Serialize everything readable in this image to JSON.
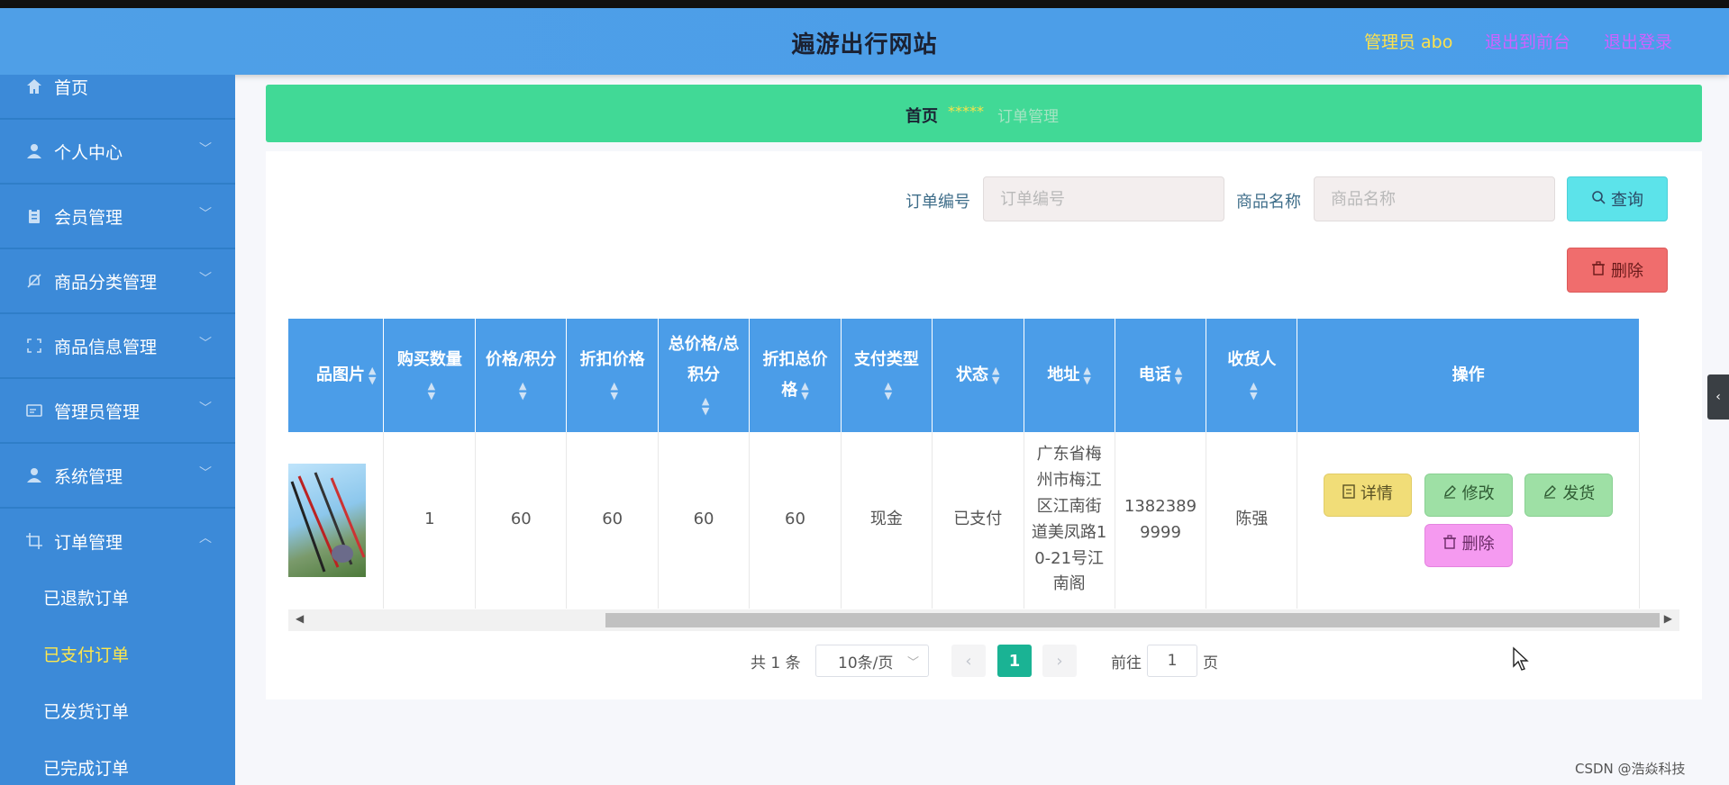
{
  "header": {
    "site_title": "遍游出行网站",
    "admin_label": "管理员 abo",
    "back_to_front": "退出到前台",
    "logout": "退出登录"
  },
  "sidebar": {
    "items": [
      {
        "label": "首页",
        "icon": "home-icon"
      },
      {
        "label": "个人中心",
        "icon": "user-icon"
      },
      {
        "label": "会员管理",
        "icon": "clipboard-icon"
      },
      {
        "label": "商品分类管理",
        "icon": "bell-off-icon"
      },
      {
        "label": "商品信息管理",
        "icon": "fullscreen-icon"
      },
      {
        "label": "管理员管理",
        "icon": "card-icon"
      },
      {
        "label": "系统管理",
        "icon": "user-icon"
      },
      {
        "label": "订单管理",
        "icon": "crop-icon"
      }
    ],
    "submenu": [
      "已退款订单",
      "已支付订单",
      "已发货订单",
      "已完成订单"
    ],
    "active_submenu": "已支付订单"
  },
  "breadcrumb": {
    "home": "首页",
    "separator": "*****",
    "current": "订单管理"
  },
  "search": {
    "order_no_label": "订单编号",
    "order_no_placeholder": "订单编号",
    "product_name_label": "商品名称",
    "product_name_placeholder": "商品名称",
    "query_button": "查询",
    "delete_button": "删除"
  },
  "table": {
    "columns": [
      "品图片",
      "购买数量",
      "价格/积分",
      "折扣价格",
      "总价格/总积分",
      "折扣总价格",
      "支付类型",
      "状态",
      "地址",
      "电话",
      "收货人",
      "操作"
    ],
    "rows": [
      {
        "quantity": "1",
        "price": "60",
        "discount_price": "60",
        "total": "60",
        "discount_total": "60",
        "pay_type": "现金",
        "status": "已支付",
        "address": "广东省梅州市梅江区江南街道美凤路10-21号江南阁",
        "phone": "13823899999",
        "receiver": "陈强",
        "actions": {
          "detail": "详情",
          "edit": "修改",
          "ship": "发货",
          "delete": "删除"
        }
      }
    ]
  },
  "pagination": {
    "total_text": "共 1 条",
    "page_size": "10条/页",
    "current_page": "1",
    "goto_label": "前往",
    "goto_value": "1",
    "goto_unit": "页"
  },
  "watermark": "CSDN @浩焱科技",
  "colors": {
    "header_bg": "#4a9ee9",
    "sidebar_bg": "#3c8ad8",
    "breadcrumb_bg": "#41d996",
    "table_header_bg": "#4b9de8",
    "pagination_active": "#1ab394"
  }
}
